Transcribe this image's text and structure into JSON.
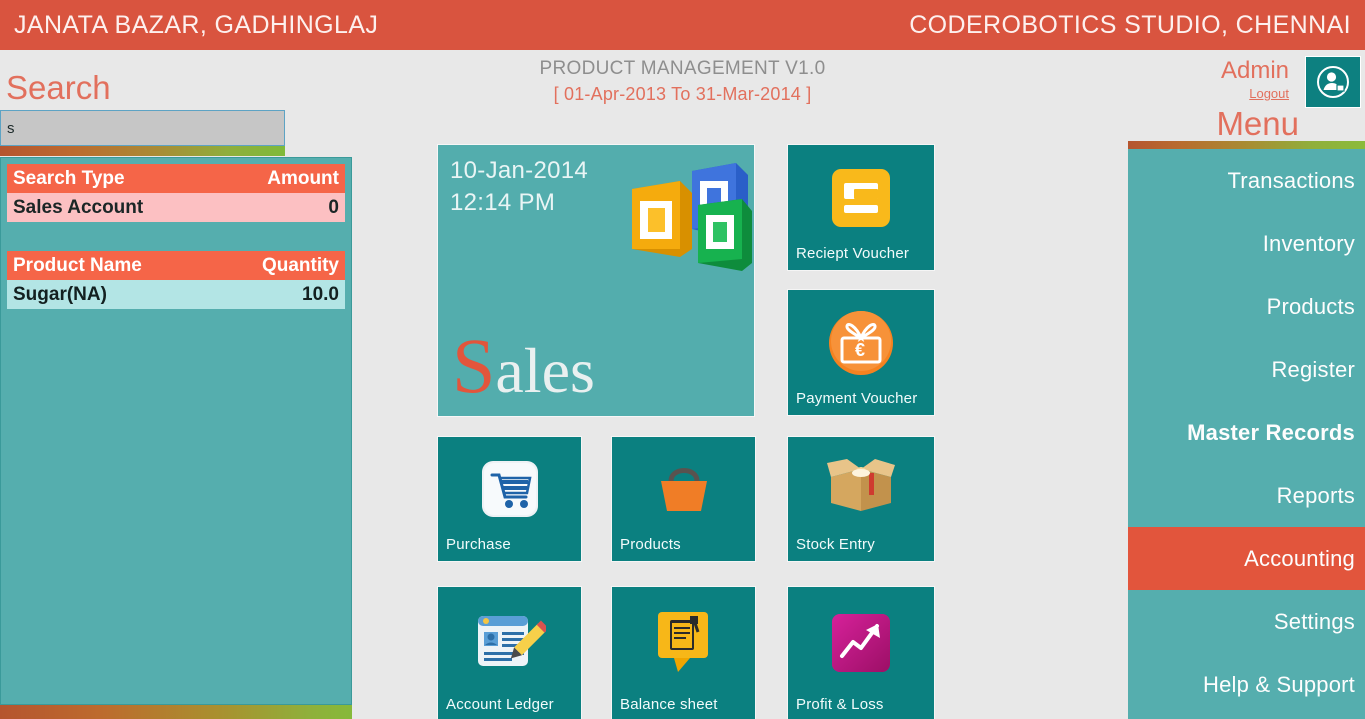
{
  "topbar": {
    "left_title": "JANATA BAZAR, GADHINGLAJ",
    "right_title": "CODEROBOTICS STUDIO, CHENNAI",
    "bg_color": "#d9543f"
  },
  "header": {
    "app_title": "PRODUCT MANAGEMENT V1.0",
    "period_range": "[ 01-Apr-2013 To 31-Mar-2014 ]"
  },
  "search": {
    "label": "Search",
    "input_value": "s",
    "placeholder": "",
    "results": {
      "header_left": "Search Type",
      "header_right": "Amount",
      "account_row": {
        "name": "Sales Account",
        "value": "0"
      },
      "product_header_left": "Product Name",
      "product_header_right": "Quantity",
      "product_row": {
        "name": "Sugar(NA)",
        "value": "10.0"
      }
    }
  },
  "user": {
    "name": "Admin",
    "logout": "Logout",
    "avatar_icon": "user-profile-icon"
  },
  "menu": {
    "label": "Menu",
    "active_item": "Accounting",
    "items": [
      {
        "label": "Transactions",
        "active": false
      },
      {
        "label": "Inventory",
        "active": false
      },
      {
        "label": "Products",
        "active": false
      },
      {
        "label": "Register",
        "active": false
      },
      {
        "label": "Master Records",
        "active": false
      },
      {
        "label": "Reports",
        "active": false
      },
      {
        "label": "Accounting",
        "active": true
      },
      {
        "label": "Settings",
        "active": false
      },
      {
        "label": "Help & Support",
        "active": false
      }
    ]
  },
  "sales_tile": {
    "date": "10-Jan-2014",
    "time": "12:14 PM",
    "word_cap": "S",
    "word_rest": "ales",
    "icon": "ms-office-squares-icon"
  },
  "tiles": [
    {
      "key": "reciept_voucher",
      "label": "Reciept Voucher",
      "icon": "voucher-card-icon"
    },
    {
      "key": "payment_voucher",
      "label": "Payment Voucher",
      "icon": "gift-euro-icon"
    },
    {
      "key": "purchase",
      "label": "Purchase",
      "icon": "shopping-cart-icon"
    },
    {
      "key": "products",
      "label": "Products",
      "icon": "shopping-basket-icon"
    },
    {
      "key": "stock_entry",
      "label": "Stock Entry",
      "icon": "open-box-icon"
    },
    {
      "key": "account_ledger",
      "label": "Account Ledger",
      "icon": "ledger-card-pencil-icon"
    },
    {
      "key": "balance_sheet",
      "label": "Balance sheet",
      "icon": "notepad-bubble-icon"
    },
    {
      "key": "profit_loss",
      "label": "Profit & Loss",
      "icon": "trend-arrow-icon"
    }
  ],
  "colors": {
    "accent_red": "#d9543f",
    "teal_light": "#55aeae",
    "teal_tile": "#0b8080",
    "highlight_red": "#e2553c"
  }
}
